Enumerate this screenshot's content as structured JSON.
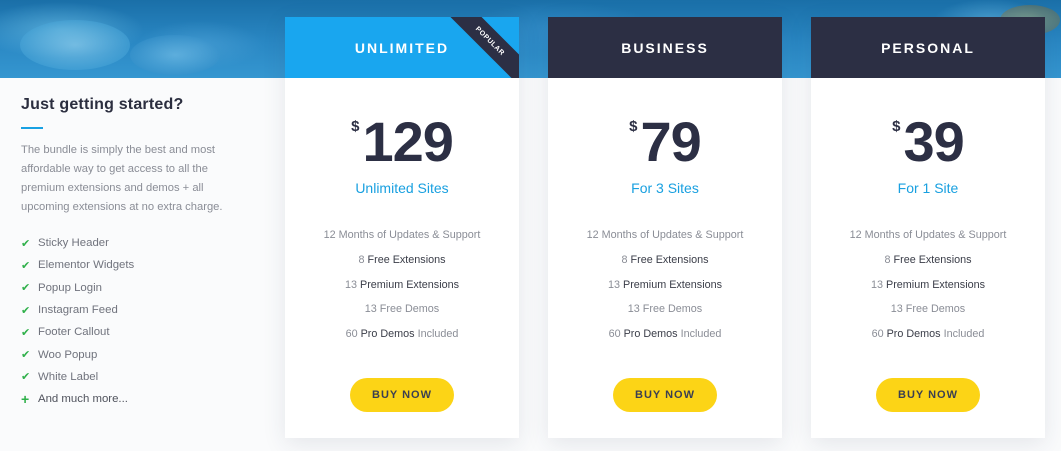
{
  "sidebar": {
    "title": "Just getting started?",
    "description": "The bundle is simply the best and most affordable way to get access to all the premium extensions and demos + all upcoming extensions at no extra charge.",
    "features": [
      {
        "icon": "check-icon",
        "label": "Sticky Header"
      },
      {
        "icon": "check-icon",
        "label": "Elementor Widgets"
      },
      {
        "icon": "check-icon",
        "label": "Popup Login"
      },
      {
        "icon": "check-icon",
        "label": "Instagram Feed"
      },
      {
        "icon": "check-icon",
        "label": "Footer Callout"
      },
      {
        "icon": "check-icon",
        "label": "Woo Popup"
      },
      {
        "icon": "check-icon",
        "label": "White Label"
      },
      {
        "icon": "plus-icon",
        "label": "And much more..."
      }
    ]
  },
  "plans": [
    {
      "name": "UNLIMITED",
      "badge": "POPULAR",
      "currency": "$",
      "price": "129",
      "sites": "Unlimited Sites",
      "f1": "12 Months of Updates & Support",
      "f2_num": "8",
      "f2_text": "Free Extensions",
      "f3_num": "13",
      "f3_text": "Premium Extensions",
      "f4": "13 Free Demos",
      "f5_num": "60",
      "f5_bold": "Pro Demos",
      "f5_text": "Included",
      "button": "BUY NOW"
    },
    {
      "name": "BUSINESS",
      "currency": "$",
      "price": "79",
      "sites": "For 3 Sites",
      "f1": "12 Months of Updates & Support",
      "f2_num": "8",
      "f2_text": "Free Extensions",
      "f3_num": "13",
      "f3_text": "Premium Extensions",
      "f4": "13 Free Demos",
      "f5_num": "60",
      "f5_bold": "Pro Demos",
      "f5_text": "Included",
      "button": "BUY NOW"
    },
    {
      "name": "PERSONAL",
      "currency": "$",
      "price": "39",
      "sites": "For 1 Site",
      "f1": "12 Months of Updates & Support",
      "f2_num": "8",
      "f2_text": "Free Extensions",
      "f3_num": "13",
      "f3_text": "Premium Extensions",
      "f4": "13 Free Demos",
      "f5_num": "60",
      "f5_bold": "Pro Demos",
      "f5_text": "Included",
      "button": "BUY NOW"
    }
  ],
  "colors": {
    "accent": "#19a6ef",
    "dark_header": "#2c2f44",
    "button": "#fcd416",
    "check": "#2fb04a"
  }
}
